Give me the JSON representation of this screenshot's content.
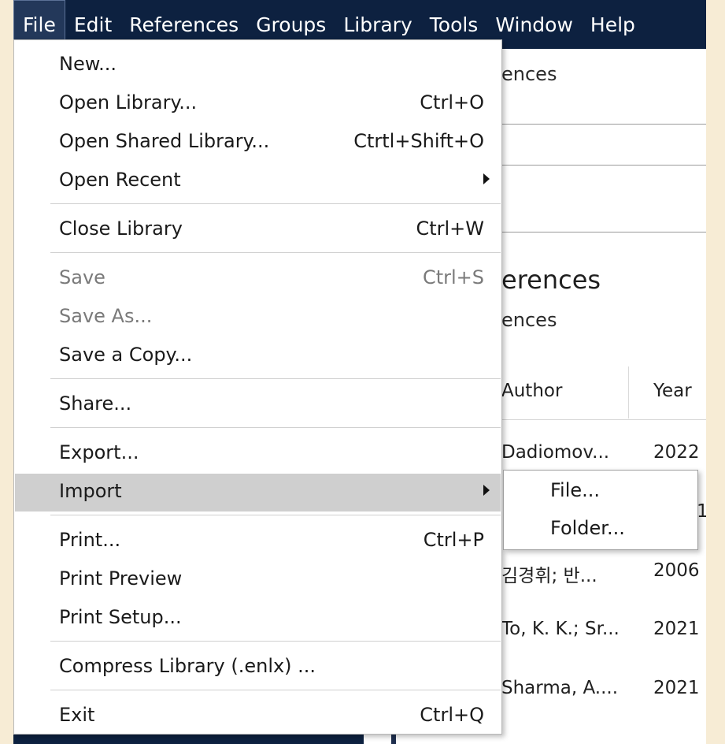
{
  "menubar": {
    "items": [
      "File",
      "Edit",
      "References",
      "Groups",
      "Library",
      "Tools",
      "Window",
      "Help"
    ]
  },
  "background": {
    "frag_top": "ences",
    "section_title": "erences",
    "section_subtitle": "ences",
    "columns": {
      "author": "Author",
      "year": "Year"
    },
    "rows": [
      {
        "author": "Dadiomov...",
        "year": "2022"
      },
      {
        "author": "",
        "year": "1"
      },
      {
        "author": "김경휘; 반...",
        "year": "2006"
      },
      {
        "author": "To, K. K.; Sr...",
        "year": "2021"
      },
      {
        "author": "Sharma, A....",
        "year": "2021"
      }
    ]
  },
  "file_menu": {
    "items": [
      {
        "label": "New...",
        "shortcut": ""
      },
      {
        "label": "Open Library...",
        "shortcut": "Ctrl+O"
      },
      {
        "label": "Open Shared Library...",
        "shortcut": "Ctrtl+Shift+O"
      },
      {
        "label": "Open Recent",
        "shortcut": ""
      },
      {
        "label": "Close Library",
        "shortcut": "Ctrl+W"
      },
      {
        "label": "Save",
        "shortcut": "Ctrl+S"
      },
      {
        "label": "Save As...",
        "shortcut": ""
      },
      {
        "label": "Save a Copy...",
        "shortcut": ""
      },
      {
        "label": "Share...",
        "shortcut": ""
      },
      {
        "label": "Export...",
        "shortcut": ""
      },
      {
        "label": "Import",
        "shortcut": ""
      },
      {
        "label": "Print...",
        "shortcut": "Ctrl+P"
      },
      {
        "label": "Print Preview",
        "shortcut": ""
      },
      {
        "label": "Print Setup...",
        "shortcut": ""
      },
      {
        "label": "Compress Library (.enlx) ...",
        "shortcut": ""
      },
      {
        "label": "Exit",
        "shortcut": "Ctrl+Q"
      }
    ]
  },
  "import_submenu": {
    "items": [
      "File...",
      "Folder..."
    ]
  },
  "icons": {
    "submenu_arrow": "chevron-right-icon"
  }
}
